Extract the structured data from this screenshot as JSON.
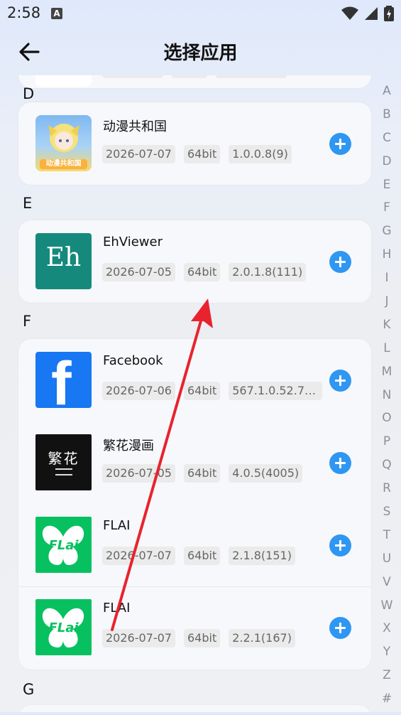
{
  "status_bar": {
    "time": "2:58",
    "notification_icon": "A"
  },
  "header": {
    "title": "选择应用",
    "back_icon": "arrow-left-icon"
  },
  "sections": [
    {
      "letter": "D",
      "apps": [
        {
          "name": "动漫共和国",
          "date": "2026-07-07",
          "arch": "64bit",
          "version": "1.0.0.8(9)",
          "icon_text": "动漫共和国"
        }
      ]
    },
    {
      "letter": "E",
      "apps": [
        {
          "name": "EhViewer",
          "date": "2026-07-05",
          "arch": "64bit",
          "version": "2.0.1.8(111)",
          "icon_text": "Eh"
        }
      ]
    },
    {
      "letter": "F",
      "apps": [
        {
          "name": "Facebook",
          "date": "2026-07-06",
          "arch": "64bit",
          "version": "567.1.0.52.74(…",
          "icon_text": "f"
        },
        {
          "name": "繁花漫画",
          "date": "2026-07-05",
          "arch": "64bit",
          "version": "4.0.5(4005)",
          "icon_text": "繁花"
        },
        {
          "name": "FLAI",
          "date": "2026-07-07",
          "arch": "64bit",
          "version": "2.1.8(151)",
          "icon_text": "FLai"
        },
        {
          "name": "FLAI",
          "date": "2026-07-07",
          "arch": "64bit",
          "version": "2.2.1(167)",
          "icon_text": "FLai"
        }
      ]
    },
    {
      "letter": "G",
      "apps": []
    }
  ],
  "alphabet_index": [
    "A",
    "B",
    "C",
    "D",
    "E",
    "F",
    "G",
    "H",
    "I",
    "J",
    "K",
    "L",
    "M",
    "N",
    "O",
    "P",
    "Q",
    "R",
    "S",
    "T",
    "U",
    "V",
    "W",
    "X",
    "Y",
    "Z",
    "#"
  ],
  "colors": {
    "accent": "#2f97f2",
    "annotation_arrow": "#e8232e"
  }
}
